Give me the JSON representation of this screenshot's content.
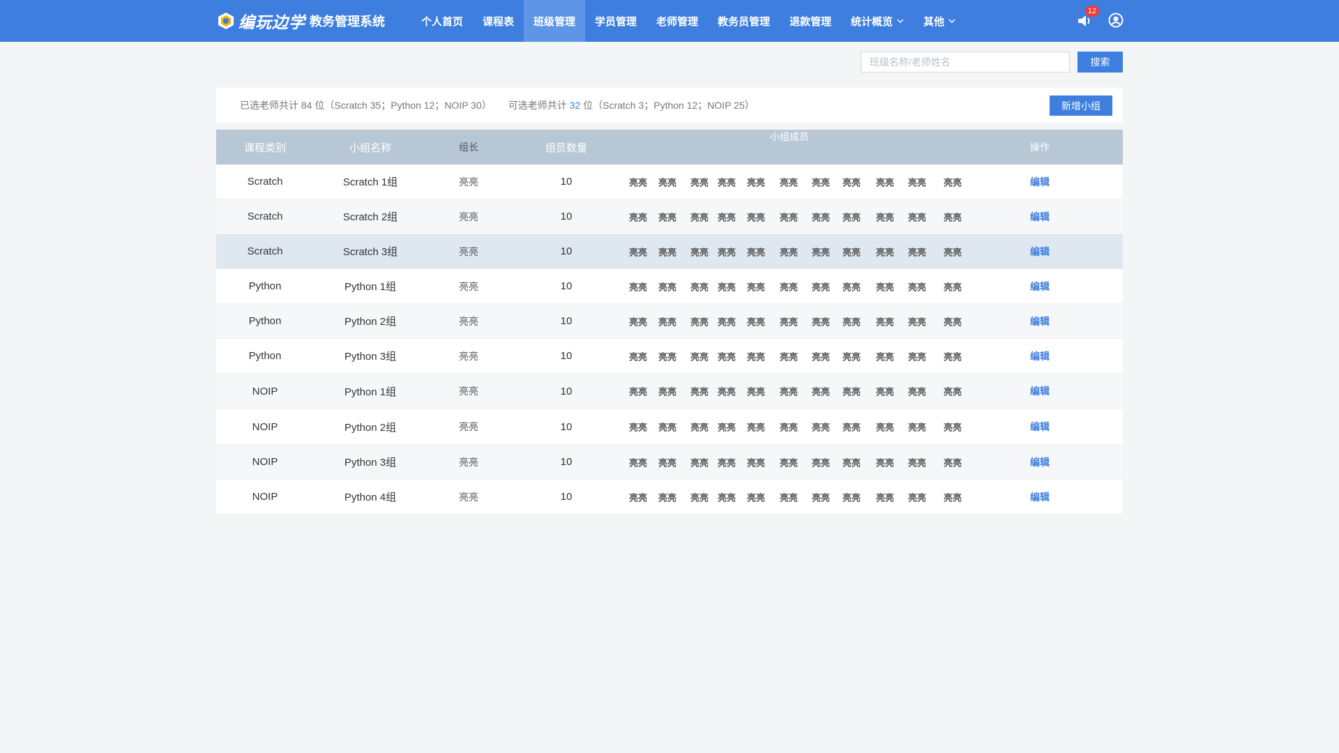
{
  "app": {
    "logo_text": "编玩边学",
    "system_name": "教务管理系统"
  },
  "nav": {
    "items": [
      {
        "label": "个人首页"
      },
      {
        "label": "课程表"
      },
      {
        "label": "班级管理",
        "active": true
      },
      {
        "label": "学员管理"
      },
      {
        "label": "老师管理"
      },
      {
        "label": "教务员管理"
      },
      {
        "label": "退款管理"
      },
      {
        "label": "统计概览",
        "dropdown": true
      },
      {
        "label": "其他",
        "dropdown": true
      }
    ],
    "notification_count": "12"
  },
  "search": {
    "placeholder": "班级名称/老师姓名",
    "value": "",
    "button_label": "搜索"
  },
  "summary": {
    "selected_text": "已选老师共计 84 位（Scratch 35；Python 12；NOIP 30）",
    "available_prefix": "可选老师共计 ",
    "available_count": "32",
    "available_suffix": " 位（Scratch 3；Python 12；NOIP 25）",
    "add_button_label": "新增小组"
  },
  "table": {
    "headers": [
      "课程类别",
      "小组名称",
      "组长",
      "组员数量",
      "小组成员",
      "操作"
    ],
    "rows": [
      {
        "category": "Scratch",
        "group": "Scratch 1组",
        "leader": "亮亮",
        "count": "10",
        "members": [
          "亮亮",
          "亮亮",
          "亮亮",
          "亮亮",
          "亮亮",
          "亮亮",
          "亮亮",
          "亮亮",
          "亮亮",
          "亮亮",
          "亮亮"
        ],
        "action": "编辑"
      },
      {
        "category": "Scratch",
        "group": "Scratch 2组",
        "leader": "亮亮",
        "count": "10",
        "members": [
          "亮亮",
          "亮亮",
          "亮亮",
          "亮亮",
          "亮亮",
          "亮亮",
          "亮亮",
          "亮亮",
          "亮亮",
          "亮亮",
          "亮亮"
        ],
        "action": "编辑"
      },
      {
        "category": "Scratch",
        "group": "Scratch 3组",
        "leader": "亮亮",
        "count": "10",
        "members": [
          "亮亮",
          "亮亮",
          "亮亮",
          "亮亮",
          "亮亮",
          "亮亮",
          "亮亮",
          "亮亮",
          "亮亮",
          "亮亮",
          "亮亮"
        ],
        "action": "编辑"
      },
      {
        "category": "Python",
        "group": "Python 1组",
        "leader": "亮亮",
        "count": "10",
        "members": [
          "亮亮",
          "亮亮",
          "亮亮",
          "亮亮",
          "亮亮",
          "亮亮",
          "亮亮",
          "亮亮",
          "亮亮",
          "亮亮",
          "亮亮"
        ],
        "action": "编辑"
      },
      {
        "category": "Python",
        "group": "Python 2组",
        "leader": "亮亮",
        "count": "10",
        "members": [
          "亮亮",
          "亮亮",
          "亮亮",
          "亮亮",
          "亮亮",
          "亮亮",
          "亮亮",
          "亮亮",
          "亮亮",
          "亮亮",
          "亮亮"
        ],
        "action": "编辑"
      },
      {
        "category": "Python",
        "group": "Python 3组",
        "leader": "亮亮",
        "count": "10",
        "members": [
          "亮亮",
          "亮亮",
          "亮亮",
          "亮亮",
          "亮亮",
          "亮亮",
          "亮亮",
          "亮亮",
          "亮亮",
          "亮亮",
          "亮亮"
        ],
        "action": "编辑"
      },
      {
        "category": "NOIP",
        "group": "Python 1组",
        "leader": "亮亮",
        "count": "10",
        "members": [
          "亮亮",
          "亮亮",
          "亮亮",
          "亮亮",
          "亮亮",
          "亮亮",
          "亮亮",
          "亮亮",
          "亮亮",
          "亮亮",
          "亮亮"
        ],
        "action": "编辑"
      },
      {
        "category": "NOIP",
        "group": "Python 2组",
        "leader": "亮亮",
        "count": "10",
        "members": [
          "亮亮",
          "亮亮",
          "亮亮",
          "亮亮",
          "亮亮",
          "亮亮",
          "亮亮",
          "亮亮",
          "亮亮",
          "亮亮",
          "亮亮"
        ],
        "action": "编辑"
      },
      {
        "category": "NOIP",
        "group": "Python 3组",
        "leader": "亮亮",
        "count": "10",
        "members": [
          "亮亮",
          "亮亮",
          "亮亮",
          "亮亮",
          "亮亮",
          "亮亮",
          "亮亮",
          "亮亮",
          "亮亮",
          "亮亮",
          "亮亮"
        ],
        "action": "编辑"
      },
      {
        "category": "NOIP",
        "group": "Python 4组",
        "leader": "亮亮",
        "count": "10",
        "members": [
          "亮亮",
          "亮亮",
          "亮亮",
          "亮亮",
          "亮亮",
          "亮亮",
          "亮亮",
          "亮亮",
          "亮亮",
          "亮亮",
          "亮亮"
        ],
        "action": "编辑"
      }
    ]
  },
  "colors": {
    "primary": "#3d7ede",
    "nav_active": "#5f95e6",
    "table_header": "#b7c7d6",
    "row_highlight": "#dfe8f1",
    "badge": "#f03b3b"
  },
  "icons": {
    "logo": "logo-icon",
    "notification": "speaker-icon",
    "user": "user-icon",
    "dropdown": "chevron-down-icon"
  }
}
